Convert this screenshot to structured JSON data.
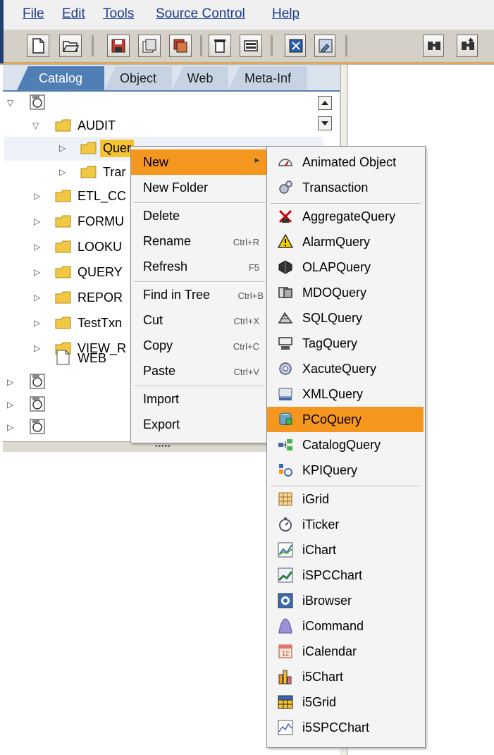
{
  "menubar": {
    "items": [
      "File",
      "Edit",
      "Tools",
      "Source Control",
      "Help"
    ]
  },
  "toolbar": {
    "buttons": [
      "new-document-icon",
      "open-folder-icon",
      "save-icon",
      "save-as-icon",
      "save-all-icon",
      "delete-icon",
      "properties-icon",
      "close-icon",
      "edit-icon",
      "find-icon",
      "find-next-icon"
    ]
  },
  "tabs": [
    "Catalog",
    "Object",
    "Web",
    "Meta-Inf"
  ],
  "tree": {
    "root_label": "",
    "items": [
      {
        "label": "AUDIT",
        "level": 1,
        "expanded": true
      },
      {
        "label": "Quer",
        "level": 2,
        "expanded": false,
        "selected": true
      },
      {
        "label": "Trar",
        "level": 2,
        "expanded": false
      },
      {
        "label": "ETL_CC",
        "level": 1,
        "expanded": false
      },
      {
        "label": "FORMU",
        "level": 1,
        "expanded": false
      },
      {
        "label": "LOOKU",
        "level": 1,
        "expanded": false
      },
      {
        "label": "QUERY",
        "level": 1,
        "expanded": false
      },
      {
        "label": "REPOR",
        "level": 1,
        "expanded": false
      },
      {
        "label": "TestTxn",
        "level": 1,
        "expanded": false
      },
      {
        "label": "VIEW_R",
        "level": 1,
        "expanded": false
      },
      {
        "label": "WEB",
        "level": 1,
        "file": true
      }
    ]
  },
  "context_menu": {
    "items": [
      {
        "label": "New",
        "shortcut": "",
        "submenu": true,
        "selected": true
      },
      {
        "label": "New Folder",
        "shortcut": ""
      },
      {
        "label": "Delete",
        "shortcut": ""
      },
      {
        "label": "Rename",
        "shortcut": "Ctrl+R"
      },
      {
        "label": "Refresh",
        "shortcut": "F5"
      },
      {
        "label": "Find in Tree",
        "shortcut": "Ctrl+B"
      },
      {
        "label": "Cut",
        "shortcut": "Ctrl+X"
      },
      {
        "label": "Copy",
        "shortcut": "Ctrl+C"
      },
      {
        "label": "Paste",
        "shortcut": "Ctrl+V"
      },
      {
        "label": "Import",
        "shortcut": ""
      },
      {
        "label": "Export",
        "shortcut": ""
      }
    ]
  },
  "submenu": {
    "items": [
      {
        "label": "Animated Object",
        "icon": "animated-object-icon"
      },
      {
        "label": "Transaction",
        "icon": "transaction-icon"
      },
      {
        "label": "AggregateQuery",
        "icon": "aggregate-query-icon"
      },
      {
        "label": "AlarmQuery",
        "icon": "alarm-query-icon"
      },
      {
        "label": "OLAPQuery",
        "icon": "olap-query-icon"
      },
      {
        "label": "MDOQuery",
        "icon": "mdo-query-icon"
      },
      {
        "label": "SQLQuery",
        "icon": "sql-query-icon"
      },
      {
        "label": "TagQuery",
        "icon": "tag-query-icon"
      },
      {
        "label": "XacuteQuery",
        "icon": "xacute-query-icon"
      },
      {
        "label": "XMLQuery",
        "icon": "xml-query-icon"
      },
      {
        "label": "PCoQuery",
        "icon": "pco-query-icon",
        "selected": true
      },
      {
        "label": "CatalogQuery",
        "icon": "catalog-query-icon"
      },
      {
        "label": "KPIQuery",
        "icon": "kpi-query-icon"
      },
      {
        "label": "iGrid",
        "icon": "igrid-icon"
      },
      {
        "label": "iTicker",
        "icon": "iticker-icon"
      },
      {
        "label": "iChart",
        "icon": "ichart-icon"
      },
      {
        "label": "iSPCChart",
        "icon": "ispcchart-icon"
      },
      {
        "label": "iBrowser",
        "icon": "ibrowser-icon"
      },
      {
        "label": "iCommand",
        "icon": "icommand-icon"
      },
      {
        "label": "iCalendar",
        "icon": "icalendar-icon"
      },
      {
        "label": "i5Chart",
        "icon": "i5chart-icon"
      },
      {
        "label": "i5Grid",
        "icon": "i5grid-icon"
      },
      {
        "label": "i5SPCChart",
        "icon": "i5spcchart-icon"
      }
    ]
  },
  "colors": {
    "menu_text": "#1a3b8c",
    "highlight": "#f5961e",
    "tab_active": "#4f7fb5",
    "tab_inactive": "#c6d3e3",
    "toolbar_bg": "#d4d0c8",
    "folder": "#f2c744"
  }
}
